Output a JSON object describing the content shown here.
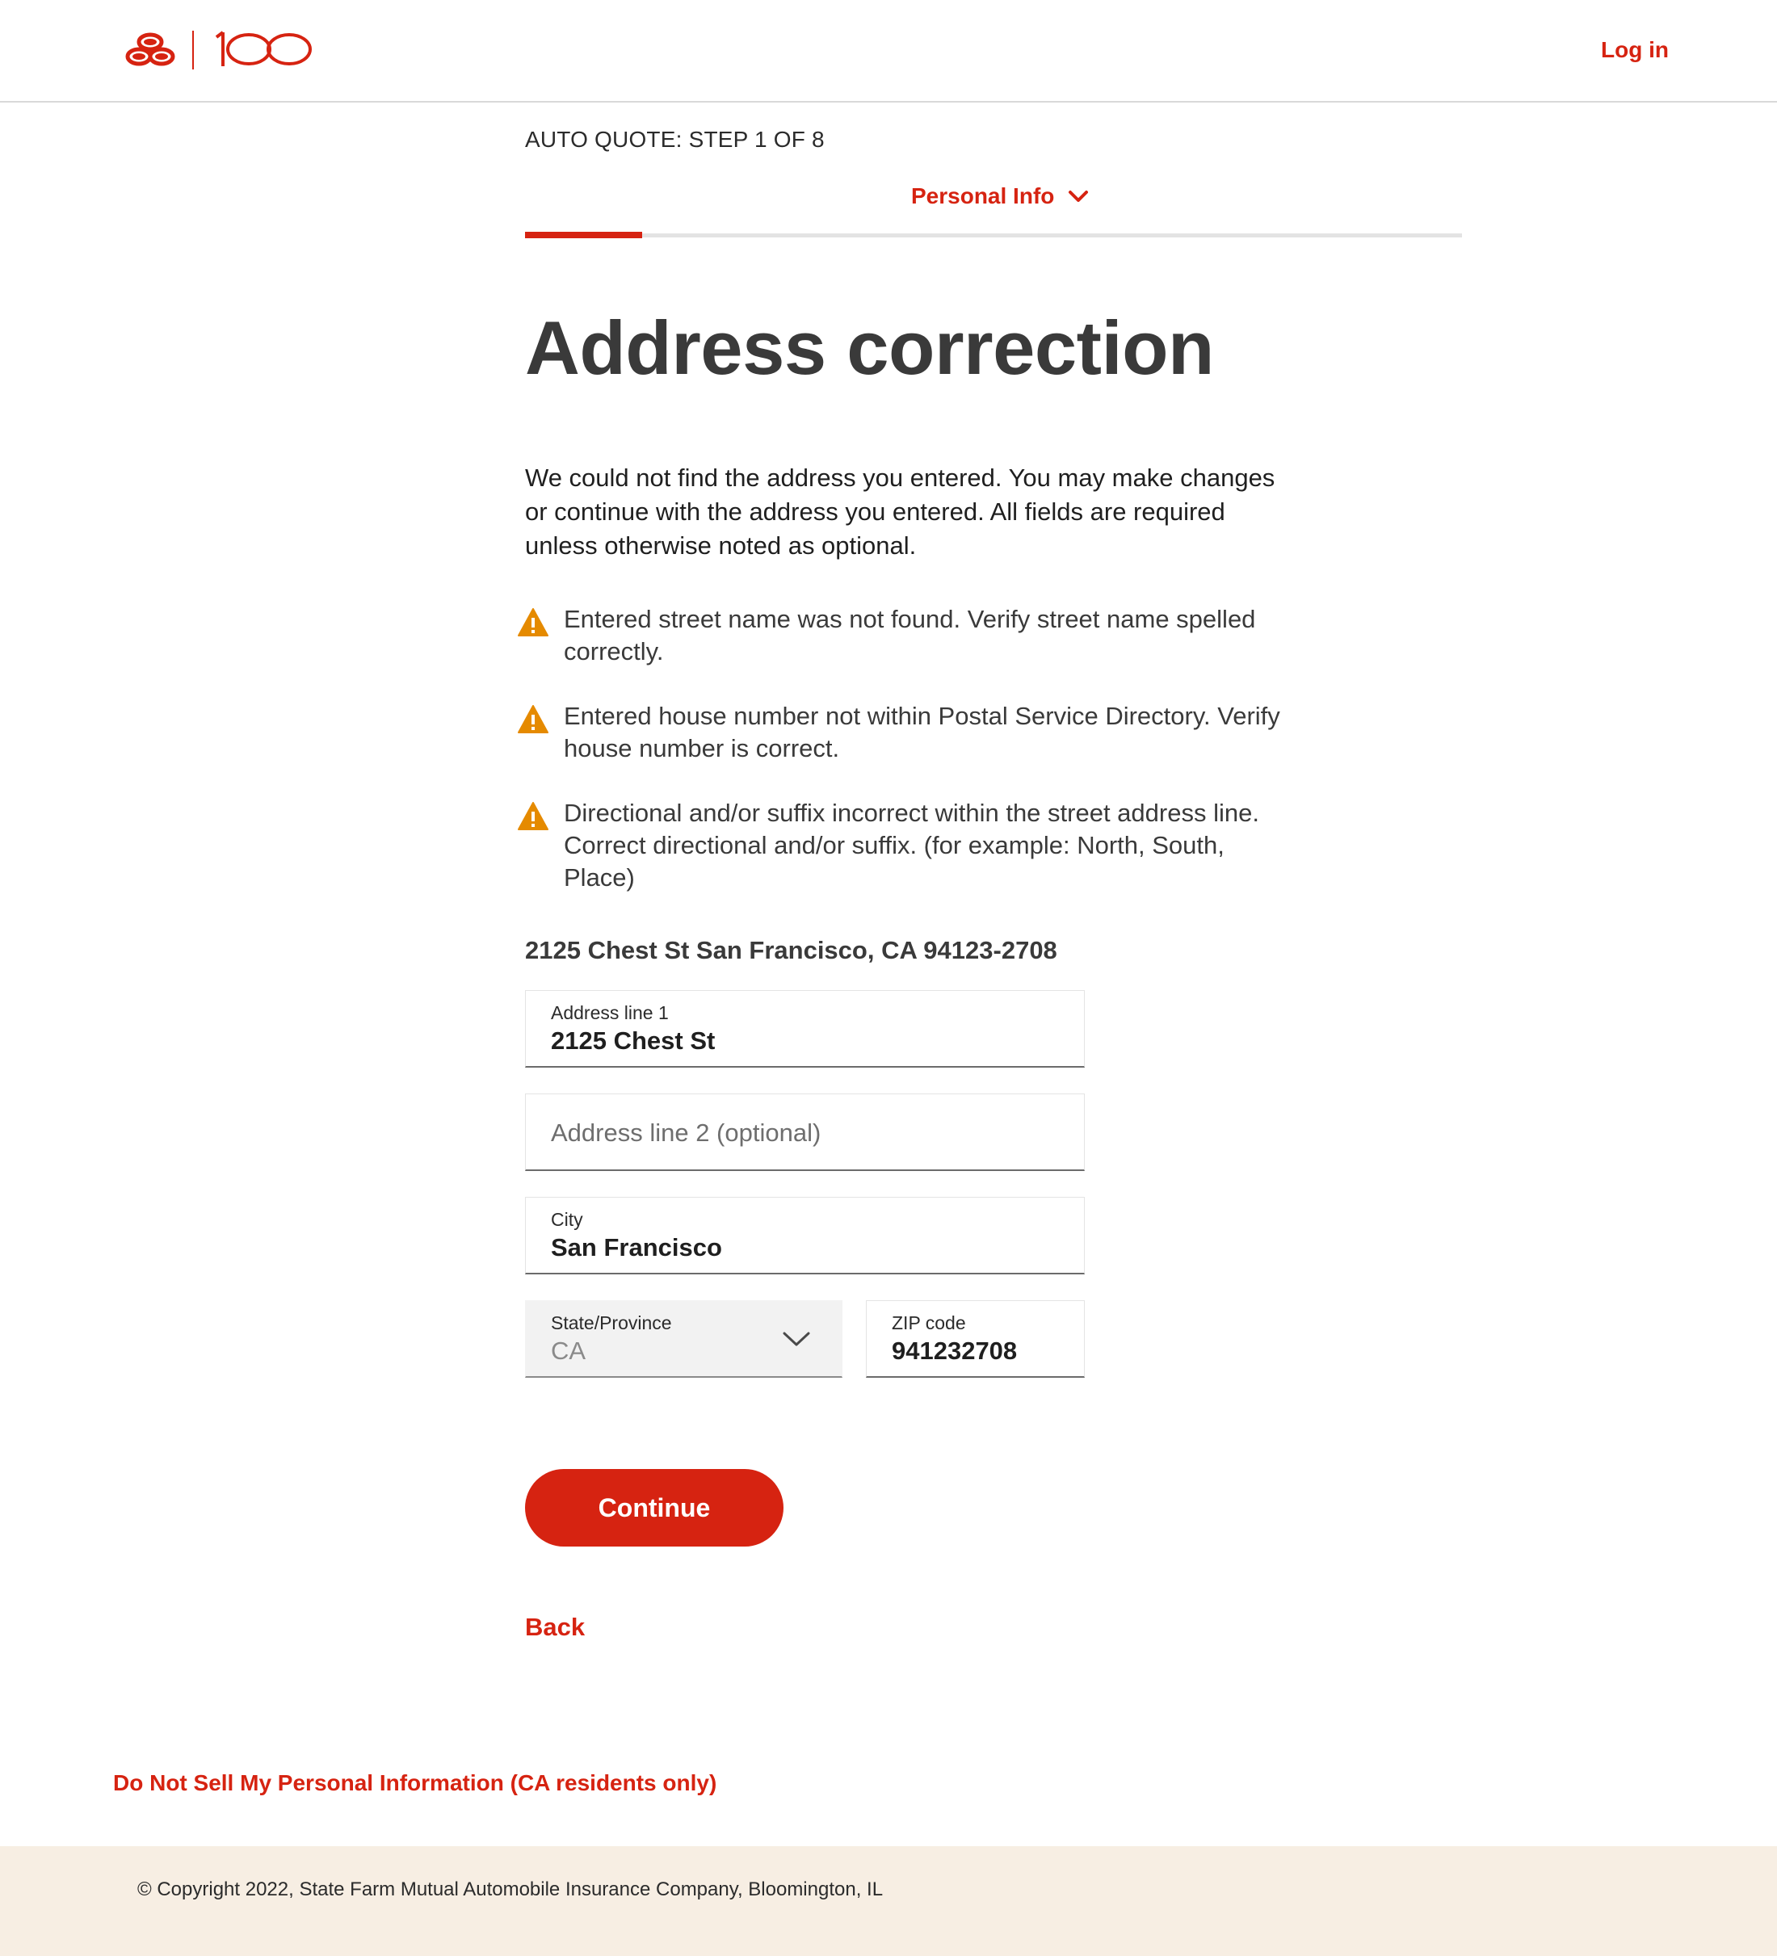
{
  "header": {
    "logo_text": "100",
    "login_label": "Log in"
  },
  "progress": {
    "step_label": "AUTO QUOTE: STEP 1 OF 8",
    "section_label": "Personal Info",
    "current_step": 1,
    "total_steps": 8,
    "fraction_complete": 0.125
  },
  "page": {
    "title": "Address correction",
    "intro": "We could not find the address you entered. You may make changes or continue with the address you entered. All fields are required unless otherwise noted as optional."
  },
  "warnings": [
    {
      "icon": "warning-icon",
      "text": "Entered street name was not found. Verify street name spelled correctly."
    },
    {
      "icon": "warning-icon",
      "text": "Entered house number not within Postal Service Directory. Verify house number is correct."
    },
    {
      "icon": "warning-icon",
      "text": "Directional and/or suffix incorrect within the street address line. Correct directional and/or suffix. (for example: North, South, Place)"
    }
  ],
  "entered_address": "2125 Chest St San Francisco, CA 94123-2708",
  "form": {
    "address1": {
      "label": "Address line 1",
      "value": "2125 Chest St"
    },
    "address2": {
      "placeholder": "Address line 2 (optional)",
      "value": ""
    },
    "city": {
      "label": "City",
      "value": "San Francisco"
    },
    "state": {
      "label": "State/Province",
      "value": "CA"
    },
    "zip": {
      "label": "ZIP code",
      "value": "941232708"
    }
  },
  "actions": {
    "continue_label": "Continue",
    "back_label": "Back"
  },
  "footer": {
    "privacy_link": "Do Not Sell My Personal Information (CA residents only)",
    "copyright": "© Copyright 2022, State Farm Mutual Automobile Insurance Company, Bloomington, IL"
  },
  "colors": {
    "brand_red": "#d62311",
    "warning_orange": "#e58a00",
    "footer_bg": "#f7eee3",
    "heading_gray": "#3a3a3a"
  }
}
